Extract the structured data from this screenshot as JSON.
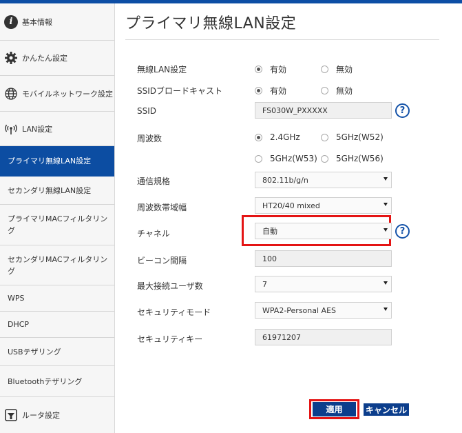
{
  "sidebar": {
    "items": [
      {
        "label": "基本情報",
        "icon": "info-icon"
      },
      {
        "label": "かんたん設定",
        "icon": "gear-icon"
      },
      {
        "label": "モバイルネットワーク設定",
        "icon": "globe-icon"
      },
      {
        "label": "LAN設定",
        "icon": "wireless-icon"
      },
      {
        "label": "プライマリ無線LAN設定",
        "active": true
      },
      {
        "label": "セカンダリ無線LAN設定"
      },
      {
        "label": "プライマリMACフィルタリング"
      },
      {
        "label": "セカンダリMACフィルタリング"
      },
      {
        "label": "WPS"
      },
      {
        "label": "DHCP"
      },
      {
        "label": "USBテザリング"
      },
      {
        "label": "Bluetoothテザリング"
      },
      {
        "label": "ルータ設定",
        "icon": "router-icon"
      }
    ]
  },
  "page": {
    "title": "プライマリ無線LAN設定"
  },
  "form": {
    "wlan": {
      "label": "無線LAN設定",
      "on": "有効",
      "off": "無効",
      "selected": "有効"
    },
    "ssid_broadcast": {
      "label": "SSIDブロードキャスト",
      "on": "有効",
      "off": "無効",
      "selected": "有効"
    },
    "ssid": {
      "label": "SSID",
      "value": "FS030W_PXXXXX"
    },
    "frequency": {
      "label": "周波数",
      "options": [
        "2.4GHz",
        "5GHz(W52)",
        "5GHz(W53)",
        "5GHz(W56)"
      ],
      "selected": "2.4GHz"
    },
    "standard": {
      "label": "通信規格",
      "value": "802.11b/g/n"
    },
    "bandwidth": {
      "label": "周波数帯域幅",
      "value": "HT20/40 mixed"
    },
    "channel": {
      "label": "チャネル",
      "value": "自動"
    },
    "beacon": {
      "label": "ビーコン間隔",
      "value": "100"
    },
    "max_users": {
      "label": "最大接続ユーザ数",
      "value": "7"
    },
    "security_mode": {
      "label": "セキュリティモード",
      "value": "WPA2-Personal AES"
    },
    "security_key": {
      "label": "セキュリティキー",
      "value": "61971207"
    },
    "help": "?"
  },
  "buttons": {
    "apply": "適用",
    "cancel": "キャンセル"
  },
  "colors": {
    "brand": "#0c4da2",
    "highlight": "#e41414"
  }
}
